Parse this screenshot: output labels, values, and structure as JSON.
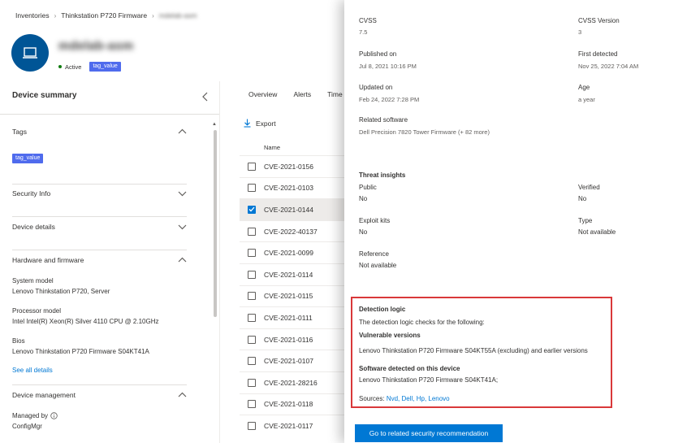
{
  "breadcrumb": {
    "items": [
      "Inventories",
      "Thinkstation P720 Firmware",
      "mdelab-asm"
    ]
  },
  "device": {
    "name": "mdelab-asm",
    "status": "Active",
    "tag": "tag_value"
  },
  "summary": {
    "title": "Device summary",
    "tags_section": {
      "label": "Tags",
      "tag": "tag_value"
    },
    "security_info": "Security Info",
    "device_details": "Device details",
    "hardware": {
      "label": "Hardware and firmware",
      "system_model_label": "System model",
      "system_model_value": "Lenovo Thinkstation P720, Server",
      "processor_label": "Processor model",
      "processor_value": "Intel Intel(R) Xeon(R) Silver 4110 CPU @ 2.10GHz",
      "bios_label": "Bios",
      "bios_value": "Lenovo Thinkstation P720 Firmware S04KT41A",
      "see_all": "See all details"
    },
    "management": {
      "label": "Device management",
      "managed_by_label": "Managed by",
      "managed_by_value": "ConfigMgr"
    }
  },
  "tabs": [
    "Overview",
    "Alerts",
    "Time"
  ],
  "toolbar": {
    "export_label": "Export"
  },
  "table": {
    "column": "Name",
    "rows": [
      {
        "name": "CVE-2021-0156",
        "checked": false
      },
      {
        "name": "CVE-2021-0103",
        "checked": false
      },
      {
        "name": "CVE-2021-0144",
        "checked": true
      },
      {
        "name": "CVE-2022-40137",
        "checked": false
      },
      {
        "name": "CVE-2021-0099",
        "checked": false
      },
      {
        "name": "CVE-2021-0114",
        "checked": false
      },
      {
        "name": "CVE-2021-0115",
        "checked": false
      },
      {
        "name": "CVE-2021-0111",
        "checked": false
      },
      {
        "name": "CVE-2021-0116",
        "checked": false
      },
      {
        "name": "CVE-2021-0107",
        "checked": false
      },
      {
        "name": "CVE-2021-28216",
        "checked": false
      },
      {
        "name": "CVE-2021-0118",
        "checked": false
      },
      {
        "name": "CVE-2021-0117",
        "checked": false
      }
    ]
  },
  "panel": {
    "cvss_label": "CVSS",
    "cvss_value": "7.5",
    "cvss_version_label": "CVSS Version",
    "cvss_version_value": "3",
    "published_label": "Published on",
    "published_value": "Jul 8, 2021 10:16 PM",
    "first_detected_label": "First detected",
    "first_detected_value": "Nov 25, 2022 7:04 AM",
    "updated_label": "Updated on",
    "updated_value": "Feb 24, 2022 7:28 PM",
    "age_label": "Age",
    "age_value": "a year",
    "related_software_label": "Related software",
    "related_software_value": "Dell Precision 7820 Tower Firmware (+ 82 more)",
    "threat_insights": "Threat insights",
    "public_label": "Public",
    "public_value": "No",
    "verified_label": "Verified",
    "verified_value": "No",
    "exploit_kits_label": "Exploit kits",
    "exploit_kits_value": "No",
    "type_label": "Type",
    "type_value": "Not available",
    "reference_label": "Reference",
    "reference_value": "Not available",
    "detection": {
      "title": "Detection logic",
      "intro": "The detection logic checks for the following:",
      "vulnerable_label": "Vulnerable versions",
      "vulnerable_value": "Lenovo Thinkstation P720 Firmware S04KT55A (excluding) and earlier versions",
      "detected_label": "Software detected on this device",
      "detected_value": "Lenovo Thinkstation P720 Firmware S04KT41A;",
      "sources_label": "Sources:",
      "sources_links": "Nvd, Dell, Hp, Lenovo"
    },
    "action_button": "Go to related security recommendation"
  },
  "colors": {
    "accent": "#0078d4",
    "avatar": "#005596",
    "tag": "#4f6bed",
    "highlight_border": "#d9383a",
    "active_status": "#107c10"
  }
}
